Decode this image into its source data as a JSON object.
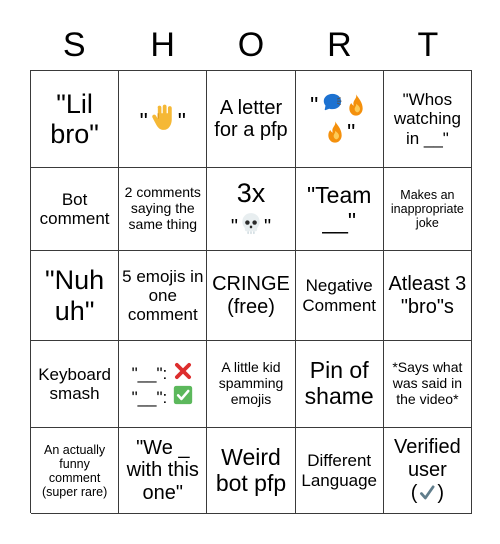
{
  "card": {
    "title_letters": [
      "S",
      "H",
      "O",
      "R",
      "T"
    ],
    "grid_size": "5x5",
    "colors": {
      "border": "#3a3a3a",
      "text": "#000000",
      "background": "#ffffff",
      "cross_mark": "#dd2e2e",
      "check_box_green": "#5cb85c",
      "verified_check": "#607d8b",
      "fire_orange": "#f4900c",
      "speaking_head_blue": "#1d72d1",
      "pointing_hand_yellow": "#f5b836",
      "skull_white": "#e8eef0"
    },
    "rows": [
      [
        {
          "id": "cell-0-0",
          "text": "\"Lil bro\"",
          "size": "xxl",
          "icons": []
        },
        {
          "id": "cell-0-1",
          "text": "\" \"",
          "size": "xl",
          "icons": [
            "pointing-down-hand-emoji"
          ]
        },
        {
          "id": "cell-0-2",
          "text": "A letter for a pfp",
          "size": "l",
          "icons": []
        },
        {
          "id": "cell-0-3",
          "text": "\" \"",
          "size": "xl",
          "icons": [
            "speaking-head-emoji",
            "fire-emoji",
            "fire-emoji"
          ]
        },
        {
          "id": "cell-0-4",
          "text": "\"Whos watching in __\"",
          "size": "m",
          "icons": []
        }
      ],
      [
        {
          "id": "cell-1-0",
          "text": "Bot comment",
          "size": "m",
          "icons": []
        },
        {
          "id": "cell-1-1",
          "text": "2 comments saying the same thing",
          "size": "s",
          "icons": []
        },
        {
          "id": "cell-1-2",
          "text": "3x \" \"",
          "size": "xxl",
          "icons": [
            "skull-emoji"
          ]
        },
        {
          "id": "cell-1-3",
          "text": "\"Team __\"",
          "size": "xl",
          "icons": []
        },
        {
          "id": "cell-1-4",
          "text": "Makes an inappropriate joke",
          "size": "xs",
          "icons": []
        }
      ],
      [
        {
          "id": "cell-2-0",
          "text": "\"Nuh uh\"",
          "size": "xxl",
          "icons": []
        },
        {
          "id": "cell-2-1",
          "text": "5 emojis in one comment",
          "size": "m",
          "icons": []
        },
        {
          "id": "cell-2-2",
          "text": "CRINGE (free)",
          "size": "l",
          "icons": []
        },
        {
          "id": "cell-2-3",
          "text": "Negative Comment",
          "size": "m",
          "icons": []
        },
        {
          "id": "cell-2-4",
          "text": "Atleast 3 \"bro\"s",
          "size": "l",
          "icons": []
        }
      ],
      [
        {
          "id": "cell-3-0",
          "text": "Keyboard smash",
          "size": "m",
          "icons": []
        },
        {
          "id": "cell-3-1",
          "text": "\"__\": \"__\": ",
          "size": "m",
          "icons": [
            "cross-mark-emoji",
            "check-mark-button-emoji"
          ]
        },
        {
          "id": "cell-3-2",
          "text": "A little kid spamming emojis",
          "size": "s",
          "icons": []
        },
        {
          "id": "cell-3-3",
          "text": "Pin of shame",
          "size": "xl",
          "icons": []
        },
        {
          "id": "cell-3-4",
          "text": "*Says what was said in the video*",
          "size": "s",
          "icons": []
        }
      ],
      [
        {
          "id": "cell-4-0",
          "text": "An actually funny comment (super rare)",
          "size": "xs",
          "icons": []
        },
        {
          "id": "cell-4-1",
          "text": "\"We _ with this one\"",
          "size": "l",
          "icons": []
        },
        {
          "id": "cell-4-2",
          "text": "Weird bot pfp",
          "size": "xl",
          "icons": []
        },
        {
          "id": "cell-4-3",
          "text": "Different Language",
          "size": "m",
          "icons": []
        },
        {
          "id": "cell-4-4",
          "text": "Verified user ( )",
          "size": "l",
          "icons": [
            "check-mark-emoji"
          ]
        }
      ]
    ]
  }
}
